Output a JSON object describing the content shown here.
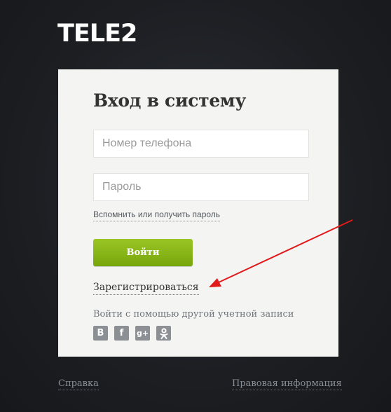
{
  "brand": {
    "logo_text": "TELE2"
  },
  "login": {
    "title": "Вход в систему",
    "phone_placeholder": "Номер телефона",
    "password_placeholder": "Пароль",
    "forgot_link": "Вспомнить или получить пароль",
    "submit_label": "Войти",
    "register_link": "Зарегистрироваться",
    "social_title": "Войти с помощью другой учетной записи",
    "social": [
      {
        "icon": "vk-icon",
        "glyph": "B"
      },
      {
        "icon": "facebook-icon",
        "glyph": "f"
      },
      {
        "icon": "google-plus-icon",
        "glyph": "g+"
      },
      {
        "icon": "odnoklassniki-icon",
        "glyph": "ok"
      }
    ]
  },
  "footer": {
    "help_link": "Справка",
    "legal_link": "Правовая информация"
  },
  "colors": {
    "background": "#1d1f24",
    "card": "#f4f4f3",
    "button": "#86b516",
    "annotation_arrow": "#e01a1a"
  }
}
